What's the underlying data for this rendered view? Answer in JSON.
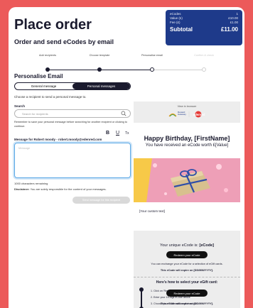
{
  "header": {
    "title": "Place order",
    "subtitle": "Order and send eCodes by email"
  },
  "summary": {
    "rows": [
      {
        "label": "eCodes",
        "value": "1"
      },
      {
        "label": "Value (£)",
        "value": "£10.00"
      },
      {
        "label": "Fee (£)",
        "value": "£1.00"
      }
    ],
    "subtotal_label": "Subtotal",
    "subtotal_value": "£11.00"
  },
  "steps": {
    "items": [
      "Add recipients",
      "Choose template",
      "Personalise email",
      "Confirm & check"
    ],
    "current_index": 2
  },
  "personalise": {
    "section_title": "Personalise Email",
    "tabs": [
      {
        "label": "General message",
        "active": false
      },
      {
        "label": "Personal messages",
        "active": true
      }
    ],
    "choose_text": "Choose a recipient to send a personal message to.",
    "search_label": "Search",
    "search_placeholder": "Search for recipients",
    "remember_text": "Remember to save your personal message before searching for another recipient or clicking to continue.",
    "format_bold": "B",
    "format_underline": "U",
    "format_clear": "Tx",
    "message_label": "Message for Robert moody - robert.moody@edenred.com",
    "message_placeholder": "Message",
    "chars_remaining": "1000 characters remaining",
    "disclaimer_bold": "Disclaimer:",
    "disclaimer_text": "You are solely responsible for the content of your messages.",
    "send_button": "Send message for this recipient"
  },
  "preview": {
    "label": "View in browser",
    "logo_text": "Reward Gateway",
    "brand_text": "edenred",
    "heading": "Happy Birthday, [FirstName]",
    "received": "You have received an eCode worth £[Value]",
    "custom_text": "[Your custom text]",
    "code_title_prefix": "Your unique eCode is: ",
    "code_title_token": "[eCode]",
    "redeem_button": "Redeem your eCode",
    "exchange_text": "You can exchange your eCode for a selection of eGift cards.",
    "expire_text": "This eCode will expire on [DD/MM/YYYY].",
    "howto_title": "Here's how to select your eGift card:",
    "howto_steps": [
      "1. Click on 'Redeem your eCode'",
      "2. Enter your 19-digit eCode above",
      "3. Choose your eGift cards and checkout"
    ],
    "redeem_button_2": "Redeem your eCode",
    "expire_text_2": "This eCode will expire on [DD/MM/YYYY]."
  },
  "colors": {
    "frame": "#ec5a5a",
    "summary_bg": "#1e3a8a",
    "dark": "#1a1a2e",
    "preview_bg": "#ededed",
    "photo_bg": "#ee9fb7"
  }
}
